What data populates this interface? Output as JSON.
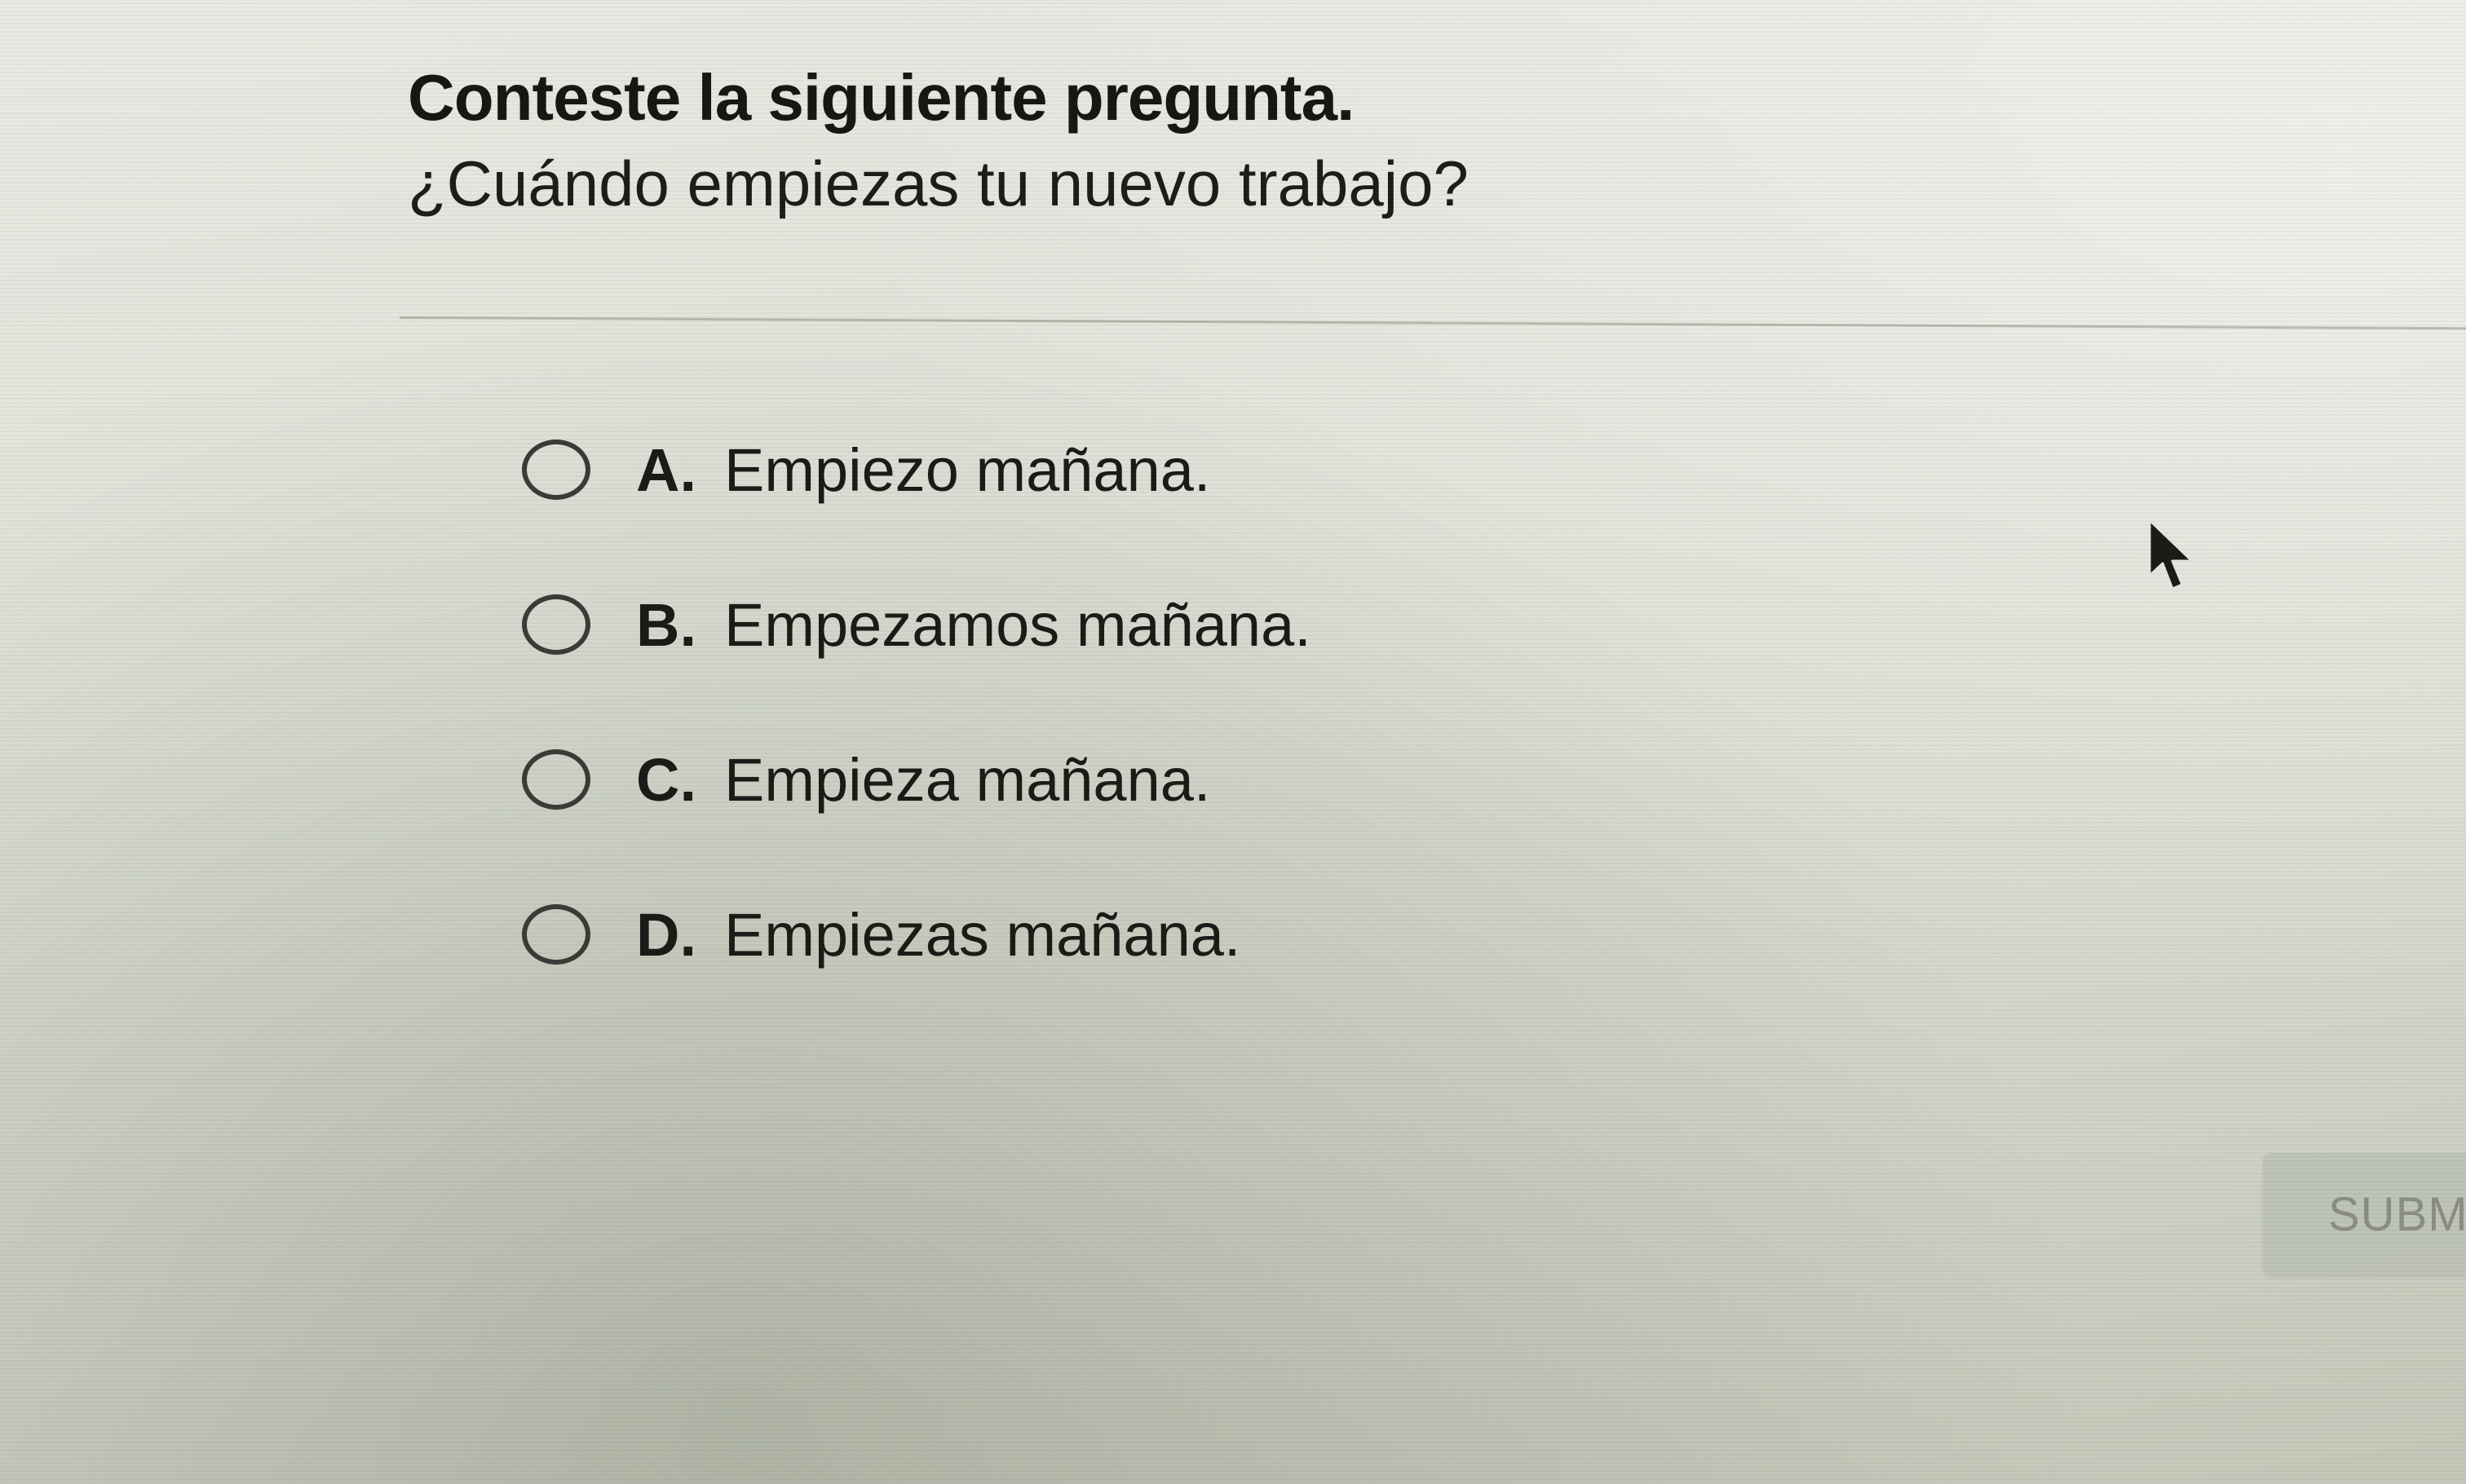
{
  "question": {
    "instruction": "Conteste la siguiente pregunta.",
    "prompt": "¿Cuándo empiezas tu nuevo trabajo?"
  },
  "options": [
    {
      "letter": "A.",
      "text": "Empiezo mañana.",
      "selected": false
    },
    {
      "letter": "B.",
      "text": "Empezamos mañana.",
      "selected": false
    },
    {
      "letter": "C.",
      "text": "Empieza mañana.",
      "selected": false
    },
    {
      "letter": "D.",
      "text": "Empiezas mañana.",
      "selected": false
    }
  ],
  "submit": {
    "label": "SUBM"
  },
  "icons": {
    "radio": "radio-unchecked-icon",
    "cursor": "mouse-pointer-icon"
  },
  "colors": {
    "background": "#dfe2d8",
    "text": "#1a1c18",
    "radio_border": "#3a3c37",
    "submit_bg": "#bec2b6",
    "submit_text": "#8a8e84"
  }
}
